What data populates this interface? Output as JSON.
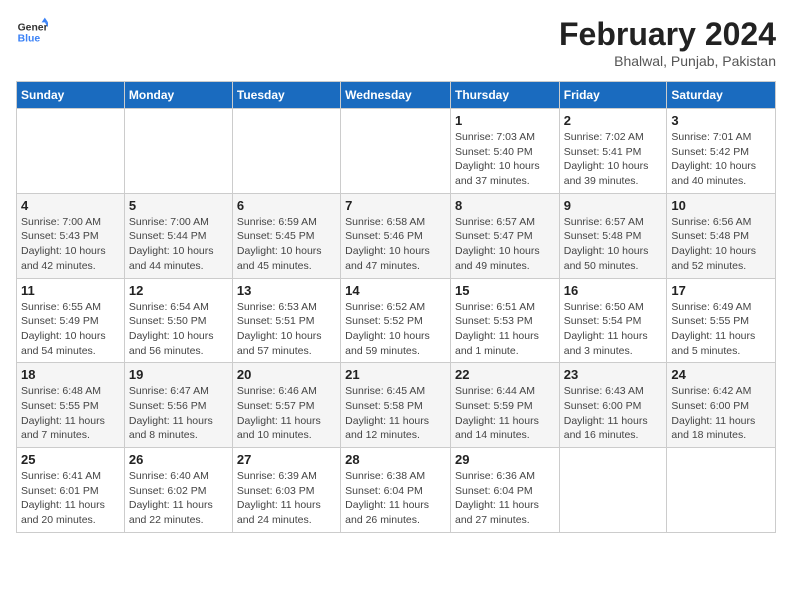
{
  "header": {
    "logo_line1": "General",
    "logo_line2": "Blue",
    "month_year": "February 2024",
    "location": "Bhalwal, Punjab, Pakistan"
  },
  "weekdays": [
    "Sunday",
    "Monday",
    "Tuesday",
    "Wednesday",
    "Thursday",
    "Friday",
    "Saturday"
  ],
  "weeks": [
    [
      {
        "day": "",
        "info": ""
      },
      {
        "day": "",
        "info": ""
      },
      {
        "day": "",
        "info": ""
      },
      {
        "day": "",
        "info": ""
      },
      {
        "day": "1",
        "info": "Sunrise: 7:03 AM\nSunset: 5:40 PM\nDaylight: 10 hours\nand 37 minutes."
      },
      {
        "day": "2",
        "info": "Sunrise: 7:02 AM\nSunset: 5:41 PM\nDaylight: 10 hours\nand 39 minutes."
      },
      {
        "day": "3",
        "info": "Sunrise: 7:01 AM\nSunset: 5:42 PM\nDaylight: 10 hours\nand 40 minutes."
      }
    ],
    [
      {
        "day": "4",
        "info": "Sunrise: 7:00 AM\nSunset: 5:43 PM\nDaylight: 10 hours\nand 42 minutes."
      },
      {
        "day": "5",
        "info": "Sunrise: 7:00 AM\nSunset: 5:44 PM\nDaylight: 10 hours\nand 44 minutes."
      },
      {
        "day": "6",
        "info": "Sunrise: 6:59 AM\nSunset: 5:45 PM\nDaylight: 10 hours\nand 45 minutes."
      },
      {
        "day": "7",
        "info": "Sunrise: 6:58 AM\nSunset: 5:46 PM\nDaylight: 10 hours\nand 47 minutes."
      },
      {
        "day": "8",
        "info": "Sunrise: 6:57 AM\nSunset: 5:47 PM\nDaylight: 10 hours\nand 49 minutes."
      },
      {
        "day": "9",
        "info": "Sunrise: 6:57 AM\nSunset: 5:48 PM\nDaylight: 10 hours\nand 50 minutes."
      },
      {
        "day": "10",
        "info": "Sunrise: 6:56 AM\nSunset: 5:48 PM\nDaylight: 10 hours\nand 52 minutes."
      }
    ],
    [
      {
        "day": "11",
        "info": "Sunrise: 6:55 AM\nSunset: 5:49 PM\nDaylight: 10 hours\nand 54 minutes."
      },
      {
        "day": "12",
        "info": "Sunrise: 6:54 AM\nSunset: 5:50 PM\nDaylight: 10 hours\nand 56 minutes."
      },
      {
        "day": "13",
        "info": "Sunrise: 6:53 AM\nSunset: 5:51 PM\nDaylight: 10 hours\nand 57 minutes."
      },
      {
        "day": "14",
        "info": "Sunrise: 6:52 AM\nSunset: 5:52 PM\nDaylight: 10 hours\nand 59 minutes."
      },
      {
        "day": "15",
        "info": "Sunrise: 6:51 AM\nSunset: 5:53 PM\nDaylight: 11 hours\nand 1 minute."
      },
      {
        "day": "16",
        "info": "Sunrise: 6:50 AM\nSunset: 5:54 PM\nDaylight: 11 hours\nand 3 minutes."
      },
      {
        "day": "17",
        "info": "Sunrise: 6:49 AM\nSunset: 5:55 PM\nDaylight: 11 hours\nand 5 minutes."
      }
    ],
    [
      {
        "day": "18",
        "info": "Sunrise: 6:48 AM\nSunset: 5:55 PM\nDaylight: 11 hours\nand 7 minutes."
      },
      {
        "day": "19",
        "info": "Sunrise: 6:47 AM\nSunset: 5:56 PM\nDaylight: 11 hours\nand 8 minutes."
      },
      {
        "day": "20",
        "info": "Sunrise: 6:46 AM\nSunset: 5:57 PM\nDaylight: 11 hours\nand 10 minutes."
      },
      {
        "day": "21",
        "info": "Sunrise: 6:45 AM\nSunset: 5:58 PM\nDaylight: 11 hours\nand 12 minutes."
      },
      {
        "day": "22",
        "info": "Sunrise: 6:44 AM\nSunset: 5:59 PM\nDaylight: 11 hours\nand 14 minutes."
      },
      {
        "day": "23",
        "info": "Sunrise: 6:43 AM\nSunset: 6:00 PM\nDaylight: 11 hours\nand 16 minutes."
      },
      {
        "day": "24",
        "info": "Sunrise: 6:42 AM\nSunset: 6:00 PM\nDaylight: 11 hours\nand 18 minutes."
      }
    ],
    [
      {
        "day": "25",
        "info": "Sunrise: 6:41 AM\nSunset: 6:01 PM\nDaylight: 11 hours\nand 20 minutes."
      },
      {
        "day": "26",
        "info": "Sunrise: 6:40 AM\nSunset: 6:02 PM\nDaylight: 11 hours\nand 22 minutes."
      },
      {
        "day": "27",
        "info": "Sunrise: 6:39 AM\nSunset: 6:03 PM\nDaylight: 11 hours\nand 24 minutes."
      },
      {
        "day": "28",
        "info": "Sunrise: 6:38 AM\nSunset: 6:04 PM\nDaylight: 11 hours\nand 26 minutes."
      },
      {
        "day": "29",
        "info": "Sunrise: 6:36 AM\nSunset: 6:04 PM\nDaylight: 11 hours\nand 27 minutes."
      },
      {
        "day": "",
        "info": ""
      },
      {
        "day": "",
        "info": ""
      }
    ]
  ]
}
